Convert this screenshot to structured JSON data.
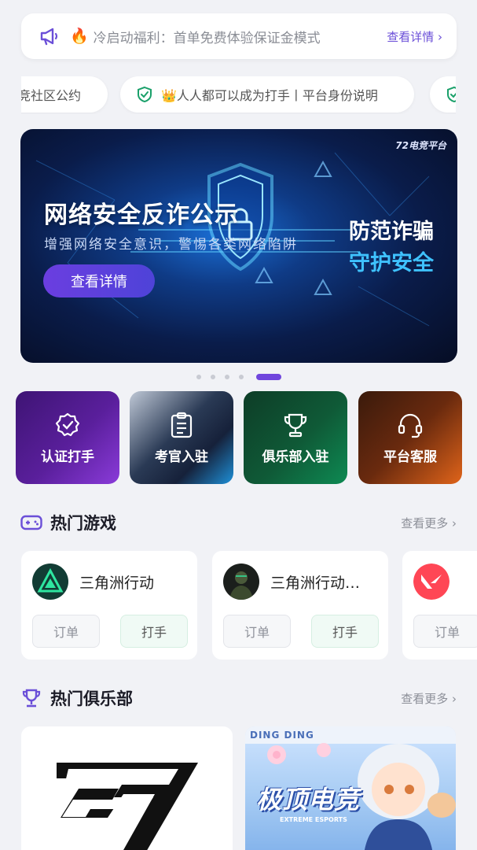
{
  "notice": {
    "icon": "megaphone-icon",
    "emoji": "🔥",
    "text": "冷启动福利：首单免费体验保证金模式",
    "link": "查看详情 ›"
  },
  "chips": [
    {
      "label": "竞社区公约"
    },
    {
      "label": "👑人人都可以成为打手丨平台身份说明"
    },
    {
      "label": ""
    }
  ],
  "banner": {
    "brand": "72电竞平台",
    "title": "网络安全反诈公示",
    "subtitle": "增强网络安全意识，警惕各类网络陷阱",
    "button": "查看详情",
    "right_line1": "防范诈骗",
    "right_line2": "守护安全"
  },
  "carousel": {
    "count": 5,
    "active_index": 4
  },
  "tiles": [
    {
      "label": "认证打手",
      "icon": "verified-badge-icon"
    },
    {
      "label": "考官入驻",
      "icon": "clipboard-icon"
    },
    {
      "label": "俱乐部入驻",
      "icon": "trophy-icon"
    },
    {
      "label": "平台客服",
      "icon": "headset-icon"
    }
  ],
  "hot_games": {
    "title": "热门游戏",
    "more": "查看更多 ›",
    "items": [
      {
        "name": "三角洲行动",
        "order": "订单",
        "player": "打手"
      },
      {
        "name": "三角洲行动…",
        "order": "订单",
        "player": "打手"
      },
      {
        "name": "",
        "order": "订单",
        "player": "打手"
      }
    ]
  },
  "hot_clubs": {
    "title": "热门俱乐部",
    "more": "查看更多 ›",
    "items": [
      {
        "logo_text": "S7"
      },
      {
        "top_text": "DING   DING",
        "logo_text": "极顶电竞",
        "sub_text": "EXTREME ESPORTS"
      }
    ]
  },
  "colors": {
    "accent": "#6b4fd8",
    "page_bg": "#f1f2f6",
    "security_green": "#1aa06a"
  }
}
